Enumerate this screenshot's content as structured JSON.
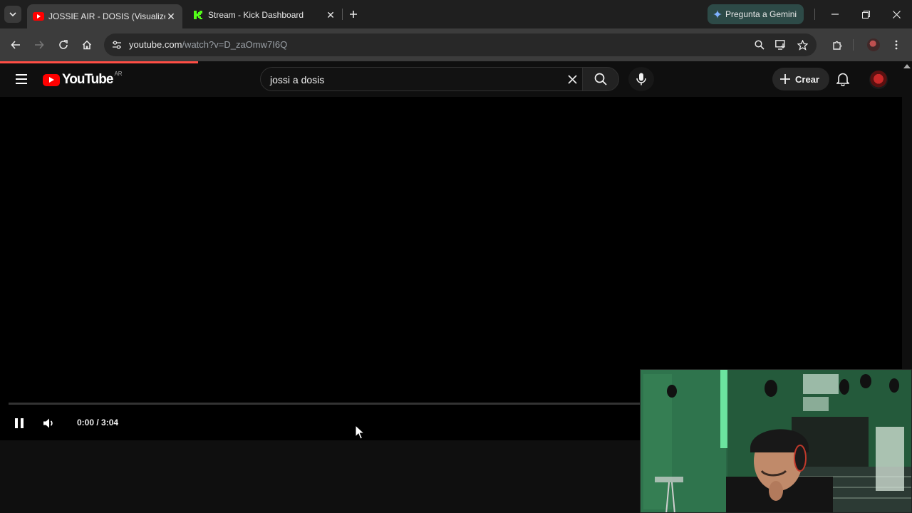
{
  "browser": {
    "tabs": [
      {
        "title": "JOSSIE AIR - DOSIS (Visualizer)",
        "icon": "youtube-favicon",
        "active": true
      },
      {
        "title": "Stream - Kick Dashboard",
        "icon": "kick-favicon",
        "active": false
      }
    ],
    "gemini_label": "Pregunta a Gemini",
    "url_host": "youtube.com",
    "url_path": "/watch?v=D_zaOmw7I6Q"
  },
  "youtube": {
    "logo_text": "YouTube",
    "country_code": "AR",
    "search_value": "jossi a dosis",
    "create_label": "Crear"
  },
  "player": {
    "time": "0:00 / 3:04",
    "progress": 0,
    "state": "playing"
  },
  "colors": {
    "accent": "#ff0000",
    "gemini_bg": "#2d4a47",
    "kick_green": "#53fc18"
  }
}
